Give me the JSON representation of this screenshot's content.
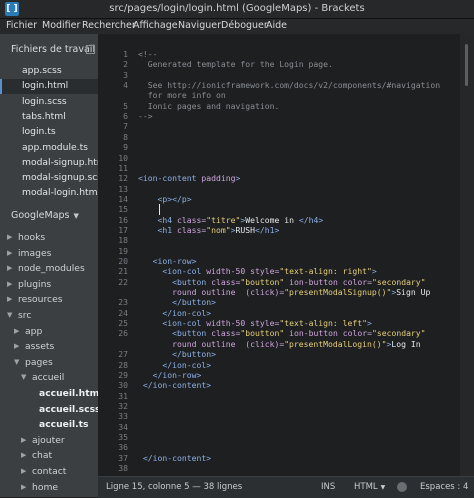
{
  "window": {
    "title": "src/pages/login/login.html (GoogleMaps) - Brackets",
    "app_icon": "brackets-icon"
  },
  "menu": [
    "Fichier",
    "Modifier",
    "Rechercher",
    "Affichage",
    "Naviguer",
    "Déboguer",
    "Aide"
  ],
  "sidebar": {
    "working_files_label": "Fichiers de travail",
    "working_files": [
      "app.scss",
      "login.html",
      "login.scss",
      "tabs.html",
      "login.ts",
      "app.module.ts",
      "modal-signup.htm",
      "modal-signup.scss",
      "modal-login.html"
    ],
    "selected_index": 1,
    "project_name": "GoogleMaps",
    "tree": [
      {
        "label": "hooks",
        "type": "folder",
        "depth": 0,
        "expanded": false
      },
      {
        "label": "images",
        "type": "folder",
        "depth": 0,
        "expanded": false
      },
      {
        "label": "node_modules",
        "type": "folder",
        "depth": 0,
        "expanded": false
      },
      {
        "label": "plugins",
        "type": "folder",
        "depth": 0,
        "expanded": false
      },
      {
        "label": "resources",
        "type": "folder",
        "depth": 0,
        "expanded": false
      },
      {
        "label": "src",
        "type": "folder",
        "depth": 0,
        "expanded": true
      },
      {
        "label": "app",
        "type": "folder",
        "depth": 1,
        "expanded": false
      },
      {
        "label": "assets",
        "type": "folder",
        "depth": 1,
        "expanded": false
      },
      {
        "label": "pages",
        "type": "folder",
        "depth": 1,
        "expanded": true
      },
      {
        "label": "accueil",
        "type": "folder",
        "depth": 2,
        "expanded": true
      },
      {
        "label": "accueil.html",
        "type": "file",
        "depth": 3
      },
      {
        "label": "accueil.scss",
        "type": "file",
        "depth": 3
      },
      {
        "label": "accueil.ts",
        "type": "file",
        "depth": 3
      },
      {
        "label": "ajouter",
        "type": "folder",
        "depth": 2,
        "expanded": false
      },
      {
        "label": "chat",
        "type": "folder",
        "depth": 2,
        "expanded": false
      },
      {
        "label": "contact",
        "type": "folder",
        "depth": 2,
        "expanded": false
      },
      {
        "label": "home",
        "type": "folder",
        "depth": 2,
        "expanded": false
      }
    ]
  },
  "editor": {
    "lines": [
      {
        "n": "1",
        "tokens": [
          [
            "cm",
            "<!--"
          ]
        ]
      },
      {
        "n": "2",
        "tokens": [
          [
            "cm",
            "  Generated template for the Login page."
          ]
        ]
      },
      {
        "n": "3",
        "tokens": []
      },
      {
        "n": "4",
        "tokens": [
          [
            "cm",
            "  See http://ionicframework.com/docs/v2/components/#navigation"
          ]
        ]
      },
      {
        "n": "",
        "tokens": [
          [
            "cm",
            "  for more info on"
          ]
        ]
      },
      {
        "n": "5",
        "tokens": [
          [
            "cm",
            "  Ionic pages and navigation."
          ]
        ]
      },
      {
        "n": "6",
        "tokens": [
          [
            "cm",
            "-->"
          ]
        ]
      },
      {
        "n": "7",
        "tokens": []
      },
      {
        "n": "8",
        "tokens": []
      },
      {
        "n": "9",
        "tokens": []
      },
      {
        "n": "10",
        "tokens": []
      },
      {
        "n": "11",
        "tokens": []
      },
      {
        "n": "12",
        "tokens": [
          [
            "tag",
            "<ion-content"
          ],
          [
            "at",
            " padding"
          ],
          [
            "tag",
            ">"
          ]
        ]
      },
      {
        "n": "13",
        "tokens": []
      },
      {
        "n": "14",
        "tokens": [
          [
            "tx",
            "    "
          ],
          [
            "tag",
            "<p></p>"
          ]
        ]
      },
      {
        "n": "15",
        "tokens": []
      },
      {
        "n": "16",
        "tokens": [
          [
            "tx",
            "    "
          ],
          [
            "tag",
            "<h4"
          ],
          [
            "at",
            " class="
          ],
          [
            "str",
            "\"titre\""
          ],
          [
            "tag",
            ">"
          ],
          [
            "tx",
            "Welcome in "
          ],
          [
            "tag",
            "</h4>"
          ]
        ]
      },
      {
        "n": "17",
        "tokens": [
          [
            "tx",
            "    "
          ],
          [
            "tag",
            "<h1"
          ],
          [
            "at",
            " class="
          ],
          [
            "str",
            "\"nom\""
          ],
          [
            "tag",
            ">"
          ],
          [
            "tx",
            "RUSH"
          ],
          [
            "tag",
            "</h1>"
          ]
        ]
      },
      {
        "n": "18",
        "tokens": []
      },
      {
        "n": "19",
        "tokens": []
      },
      {
        "n": "20",
        "tokens": [
          [
            "tx",
            "   "
          ],
          [
            "tag",
            "<ion-row>"
          ]
        ]
      },
      {
        "n": "21",
        "tokens": [
          [
            "tx",
            "     "
          ],
          [
            "tag",
            "<ion-col"
          ],
          [
            "at",
            " width-50 style="
          ],
          [
            "str",
            "\"text-align: right\""
          ],
          [
            "tag",
            ">"
          ]
        ]
      },
      {
        "n": "22",
        "tokens": [
          [
            "tx",
            "       "
          ],
          [
            "tag",
            "<button"
          ],
          [
            "at",
            " class="
          ],
          [
            "str",
            "\"boutton\""
          ],
          [
            "at",
            " ion-button color="
          ],
          [
            "str",
            "\"secondary\""
          ]
        ]
      },
      {
        "n": "",
        "tokens": [
          [
            "at",
            "       round outline  (click)="
          ],
          [
            "str",
            "\"presentModalSignup()\""
          ],
          [
            "tag",
            ">"
          ],
          [
            "tx",
            "Sign Up"
          ]
        ]
      },
      {
        "n": "23",
        "tokens": [
          [
            "tx",
            "       "
          ],
          [
            "tag",
            "</button>"
          ]
        ]
      },
      {
        "n": "24",
        "tokens": [
          [
            "tx",
            "     "
          ],
          [
            "tag",
            "</ion-col>"
          ]
        ]
      },
      {
        "n": "25",
        "tokens": [
          [
            "tx",
            "     "
          ],
          [
            "tag",
            "<ion-col"
          ],
          [
            "at",
            " width-50 style="
          ],
          [
            "str",
            "\"text-align: left\""
          ],
          [
            "tag",
            ">"
          ]
        ]
      },
      {
        "n": "26",
        "tokens": [
          [
            "tx",
            "       "
          ],
          [
            "tag",
            "<button"
          ],
          [
            "at",
            " class="
          ],
          [
            "str",
            "\"boutton\""
          ],
          [
            "at",
            " ion-button color="
          ],
          [
            "str",
            "\"secondary\""
          ]
        ]
      },
      {
        "n": "",
        "tokens": [
          [
            "at",
            "       round outline  (click)="
          ],
          [
            "str",
            "\"presentModalLogin()\""
          ],
          [
            "tag",
            ">"
          ],
          [
            "tx",
            "Log In"
          ]
        ]
      },
      {
        "n": "27",
        "tokens": [
          [
            "tx",
            "       "
          ],
          [
            "tag",
            "</button>"
          ]
        ]
      },
      {
        "n": "28",
        "tokens": [
          [
            "tx",
            "     "
          ],
          [
            "tag",
            "</ion-col>"
          ]
        ]
      },
      {
        "n": "29",
        "tokens": [
          [
            "tx",
            "   "
          ],
          [
            "tag",
            "</ion-row>"
          ]
        ]
      },
      {
        "n": "30",
        "tokens": [
          [
            "tx",
            " "
          ],
          [
            "tag",
            "</ion-content>"
          ]
        ]
      },
      {
        "n": "31",
        "tokens": []
      },
      {
        "n": "32",
        "tokens": []
      },
      {
        "n": "33",
        "tokens": []
      },
      {
        "n": "34",
        "tokens": []
      },
      {
        "n": "35",
        "tokens": []
      },
      {
        "n": "36",
        "tokens": []
      },
      {
        "n": "37",
        "tokens": [
          [
            "tx",
            " "
          ],
          [
            "tag",
            "</ion-content>"
          ]
        ]
      },
      {
        "n": "38",
        "tokens": []
      }
    ],
    "spacer_lines": [
      7,
      33
    ]
  },
  "statusbar": {
    "cursor": "Ligne 15, colonne 5 — 38 lignes",
    "ins": "INS",
    "language": "HTML",
    "lint_icon": "lint-status-icon",
    "spaces": "Espaces : 4"
  }
}
